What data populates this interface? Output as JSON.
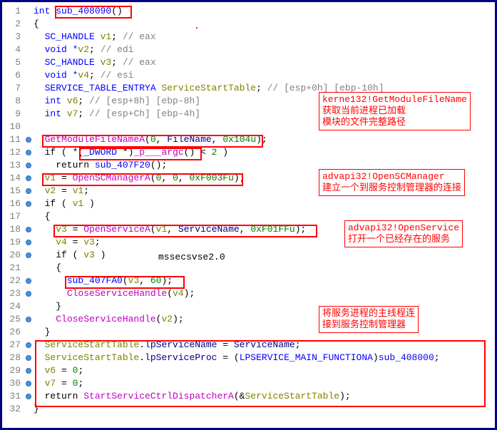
{
  "lines": {
    "l1_int": "int ",
    "l1_fn": "sub_408090",
    "l1_paren": "()",
    "l2": "{",
    "l3_t": "  SC_HANDLE ",
    "l3_v": "v1",
    "l3_c": "; ",
    "l3_cm": "// eax",
    "l4_t": "  void *",
    "l4_v": "v2",
    "l4_c": "; ",
    "l4_cm": "// edi",
    "l5_t": "  SC_HANDLE ",
    "l5_v": "v3",
    "l5_c": "; ",
    "l5_cm": "// eax",
    "l6_t": "  void *",
    "l6_v": "v4",
    "l6_c": "; ",
    "l6_cm": "// esi",
    "l7_t": "  SERVICE_TABLE_ENTRYA ",
    "l7_v": "ServiceStartTable",
    "l7_c": "; ",
    "l7_cm": "// [esp+0h] [ebp-10h]",
    "l8_t": "  int ",
    "l8_v": "v6",
    "l8_c": "; ",
    "l8_cm": "// [esp+8h] [ebp-8h]",
    "l9_t": "  int ",
    "l9_v": "v7",
    "l9_c": "; ",
    "l9_cm": "// [esp+Ch] [ebp-4h]",
    "l11_a": "  ",
    "l11_fn": "GetModuleFileNameA",
    "l11_b": "(",
    "l11_n0": "0",
    "l11_c": ", ",
    "l11_fn2": "FileName",
    "l11_d": ", ",
    "l11_n1": "0x104u",
    "l11_e": ");",
    "l12_a": "  if ( *(",
    "l12_t": "_DWORD",
    "l12_b": " *)",
    "l12_fn": "_p___argc",
    "l12_c": "() < ",
    "l12_n": "2",
    "l12_d": " )",
    "l13_a": "    return ",
    "l13_fn": "sub_407F20",
    "l13_b": "();",
    "l14_a": "  ",
    "l14_v": "v1",
    "l14_b": " = ",
    "l14_fn": "OpenSCManagerA",
    "l14_c": "(",
    "l14_n0": "0",
    "l14_d": ", ",
    "l14_n1": "0",
    "l14_e": ", ",
    "l14_n2": "0xF003Fu",
    "l14_f": ");",
    "l15_a": "  ",
    "l15_v": "v2",
    "l15_b": " = ",
    "l15_v2": "v1",
    "l15_c": ";",
    "l16_a": "  if ( ",
    "l16_v": "v1",
    "l16_b": " )",
    "l17": "  {",
    "l18_a": "    ",
    "l18_v": "v3",
    "l18_b": " = ",
    "l18_fn": "OpenServiceA",
    "l18_c": "(",
    "l18_v2": "v1",
    "l18_d": ", ",
    "l18_id": "ServiceName",
    "l18_e": ", ",
    "l18_n": "0xF01FFu",
    "l18_f": ");",
    "l19_a": "    ",
    "l19_v": "v4",
    "l19_b": " = ",
    "l19_v2": "v3",
    "l19_c": ";",
    "l20_a": "    if ( ",
    "l20_v": "v3",
    "l20_b": " )",
    "l21": "    {",
    "l22_a": "      ",
    "l22_fn": "sub_407FA0",
    "l22_b": "(",
    "l22_v": "v3",
    "l22_c": ", ",
    "l22_n": "60",
    "l22_d": ");",
    "l23_a": "      ",
    "l23_fn": "CloseServiceHandle",
    "l23_b": "(",
    "l23_v": "v4",
    "l23_c": ");",
    "l24": "    }",
    "l25_a": "    ",
    "l25_fn": "CloseServiceHandle",
    "l25_b": "(",
    "l25_v": "v2",
    "l25_c": ");",
    "l26": "  }",
    "l27_a": "  ",
    "l27_id": "ServiceStartTable",
    "l27_b": ".",
    "l27_m": "lpServiceName",
    "l27_c": " = ",
    "l27_id2": "ServiceName",
    "l27_d": ";",
    "l28_a": "  ",
    "l28_id": "ServiceStartTable",
    "l28_b": ".",
    "l28_m": "lpServiceProc",
    "l28_c": " = (",
    "l28_t": "LPSERVICE_MAIN_FUNCTIONA",
    "l28_d": ")",
    "l28_fn": "sub_408000",
    "l28_e": ";",
    "l29_a": "  ",
    "l29_v": "v6",
    "l29_b": " = ",
    "l29_n": "0",
    "l29_c": ";",
    "l30_a": "  ",
    "l30_v": "v7",
    "l30_b": " = ",
    "l30_n": "0",
    "l30_c": ";",
    "l31_a": "  return ",
    "l31_fn": "StartServiceCtrlDispatcherA",
    "l31_b": "(&",
    "l31_id": "ServiceStartTable",
    "l31_c": ");",
    "l32": "}"
  },
  "annotations": {
    "a1_l1": "kerne132!GetModuleFileName",
    "a1_l2": "获取当前进程已加载",
    "a1_l3": "模块的文件完整路径",
    "a2_l1": "advapi32!OpenSCManager",
    "a2_l2": "建立一个到服务控制管理器的连接",
    "a3_l1": "advapi32!OpenService",
    "a3_l2": "打开一个已经存在的服务",
    "a4_l1": "将服务进程的主线程连",
    "a4_l2": "接到服务控制管理器"
  },
  "label": "mssecsvse2.0",
  "dot_lines": [
    11,
    12,
    13,
    14,
    15,
    16,
    18,
    19,
    20,
    22,
    23,
    25,
    27,
    28,
    29,
    30,
    31
  ]
}
